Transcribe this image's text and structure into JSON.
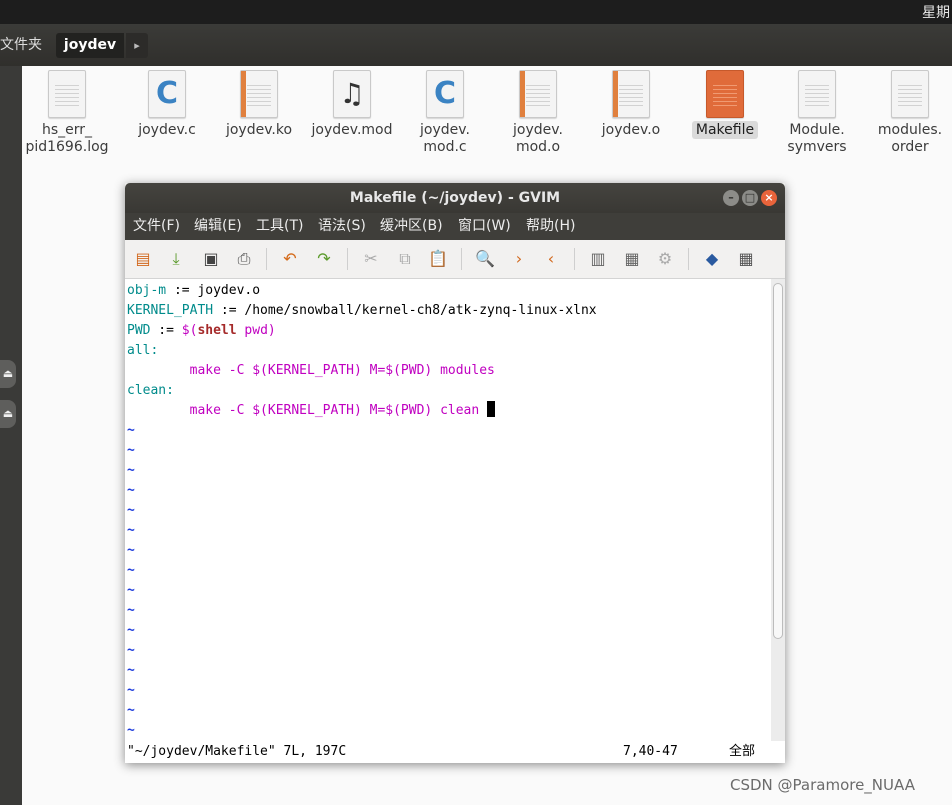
{
  "topbar": {
    "clock": "星期"
  },
  "file_manager": {
    "breadcrumb": {
      "previous": "文件夹",
      "current": "joydev",
      "more_icon": "▸"
    },
    "files": [
      {
        "name_line1": "hs_err_",
        "name_line2": "pid1696.log",
        "icon": "text-document-icon"
      },
      {
        "name_line1": "joydev.c",
        "name_line2": "",
        "icon": "c-source-icon"
      },
      {
        "name_line1": "joydev.ko",
        "name_line2": "",
        "icon": "object-file-icon"
      },
      {
        "name_line1": "joydev.mod",
        "name_line2": "",
        "icon": "audio-file-icon"
      },
      {
        "name_line1": "joydev.",
        "name_line2": "mod.c",
        "icon": "c-source-icon"
      },
      {
        "name_line1": "joydev.",
        "name_line2": "mod.o",
        "icon": "object-file-icon"
      },
      {
        "name_line1": "joydev.o",
        "name_line2": "",
        "icon": "object-file-icon"
      },
      {
        "name_line1": "Makefile",
        "name_line2": "",
        "icon": "makefile-icon",
        "selected": true
      },
      {
        "name_line1": "Module.",
        "name_line2": "symvers",
        "icon": "text-document-icon"
      },
      {
        "name_line1": "modules.",
        "name_line2": "order",
        "icon": "text-document-icon"
      }
    ]
  },
  "gvim": {
    "title": "Makefile (~/joydev) - GVIM",
    "menu": [
      "文件(F)",
      "编辑(E)",
      "工具(T)",
      "语法(S)",
      "缓冲区(B)",
      "窗口(W)",
      "帮助(H)"
    ],
    "editor": {
      "l1_a": "obj-m",
      "l1_b": " := joydev.o",
      "l2_a": "KERNEL_PATH",
      "l2_b": " := /home/snowball/kernel-ch8/atk-zynq-linux-xlnx",
      "l3_a": "PWD",
      "l3_b": " := ",
      "l3_c": "$(",
      "l3_d": "shell",
      "l3_e": " pwd)",
      "l4": "all:",
      "l5": "        make -C $(KERNEL_PATH) M=$(PWD) modules",
      "l6": "clean:",
      "l7": "        make -C $(KERNEL_PATH) M=$(PWD) clean ",
      "tilde": "~"
    },
    "status": {
      "file": "\"~/joydev/Makefile\" 7L, 197C",
      "position": "7,40-47",
      "scroll": "全部"
    }
  },
  "watermark": "CSDN @Paramore_NUAA",
  "colors": {
    "identifier": "#008b8b",
    "command": "#c000c0",
    "keyword": "#a52a2a",
    "tilde": "#1e3cdc",
    "accent_close": "#e9643b"
  }
}
